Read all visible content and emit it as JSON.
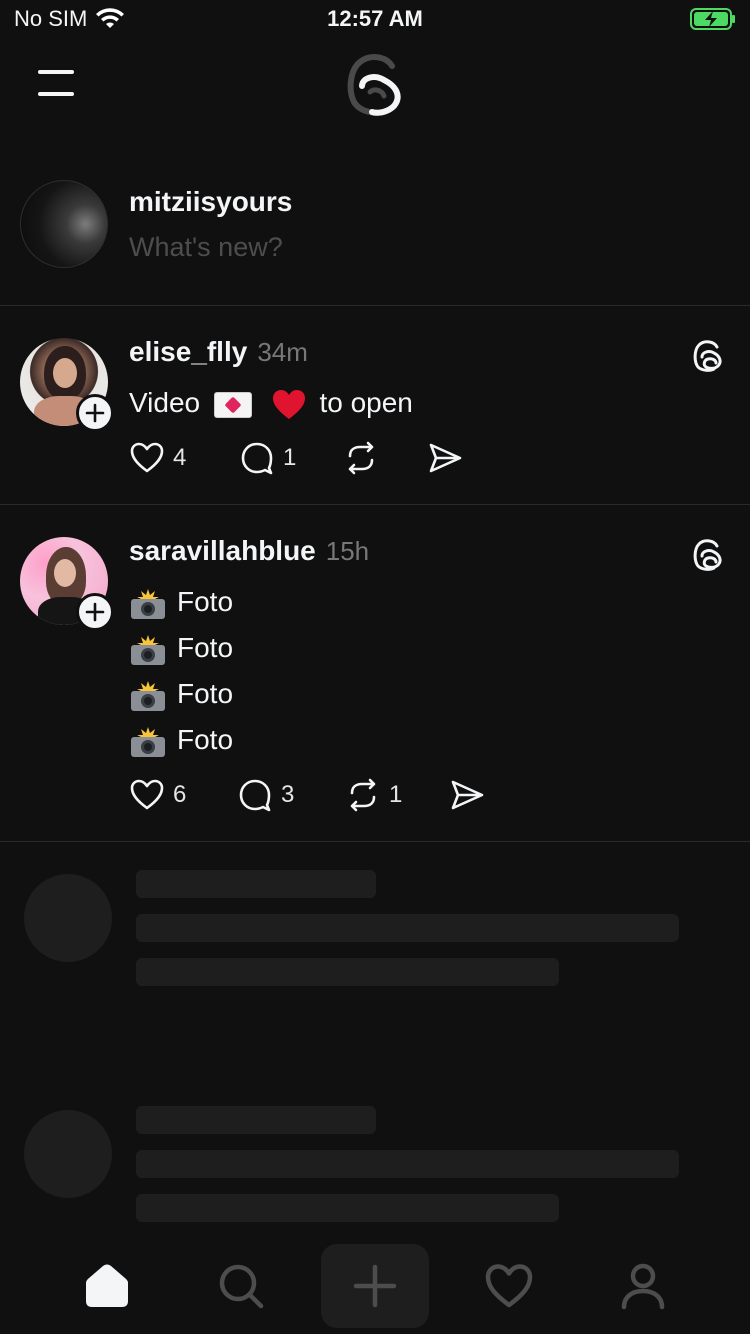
{
  "status_bar": {
    "carrier": "No SIM",
    "time": "12:57 AM"
  },
  "composer": {
    "username": "mitziisyours",
    "placeholder": "What's new?"
  },
  "posts": [
    {
      "username": "elise_flly",
      "time": "34m",
      "text_before": "Video",
      "text_after": "to open",
      "likes": "4",
      "replies": "1",
      "reposts": ""
    },
    {
      "username": "saravillahblue",
      "time": "15h",
      "lines": [
        "Foto",
        "Foto",
        "Foto",
        "Foto"
      ],
      "likes": "6",
      "replies": "3",
      "reposts": "1"
    }
  ],
  "tabs": [
    "home",
    "search",
    "compose",
    "activity",
    "profile"
  ],
  "colors": {
    "background": "#101010",
    "text": "#f3f5f7",
    "muted": "#777777",
    "skeleton": "#1e1e1e",
    "battery": "#4cd964"
  }
}
